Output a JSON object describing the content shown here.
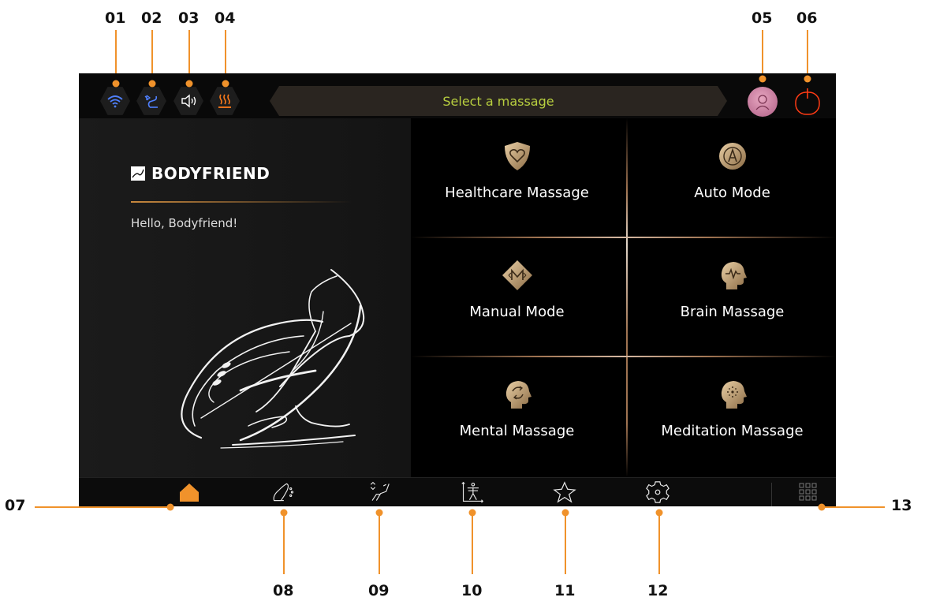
{
  "topbar": {
    "title": "Select a massage",
    "status_icons": [
      "wifi-icon",
      "bluetooth-icon",
      "volume-icon",
      "heat-icon"
    ],
    "user_icon": "user-avatar",
    "power_icon": "power-icon"
  },
  "brand": {
    "name": "BODYFRIEND",
    "greeting": "Hello, Bodyfriend!"
  },
  "menu": {
    "items": [
      {
        "label": "Healthcare Massage",
        "icon": "shield-heart-icon"
      },
      {
        "label": "Auto Mode",
        "icon": "auto-a-icon"
      },
      {
        "label": "Manual Mode",
        "icon": "manual-m-icon"
      },
      {
        "label": "Brain Massage",
        "icon": "brain-pulse-icon"
      },
      {
        "label": "Mental Massage",
        "icon": "mental-cycle-icon"
      },
      {
        "label": "Meditation Massage",
        "icon": "meditation-icon"
      }
    ]
  },
  "bottom_nav": {
    "items": [
      "home-icon",
      "chair-position-icon",
      "recline-icon",
      "body-scan-icon",
      "favorite-star-icon",
      "settings-gear-icon"
    ],
    "apps_icon": "apps-grid-icon"
  },
  "callouts": [
    "01",
    "02",
    "03",
    "04",
    "05",
    "06",
    "07",
    "08",
    "09",
    "10",
    "11",
    "12",
    "13"
  ],
  "colors": {
    "accent": "#f0922b",
    "title_text": "#b8cf3f",
    "gold": "#a07452"
  }
}
